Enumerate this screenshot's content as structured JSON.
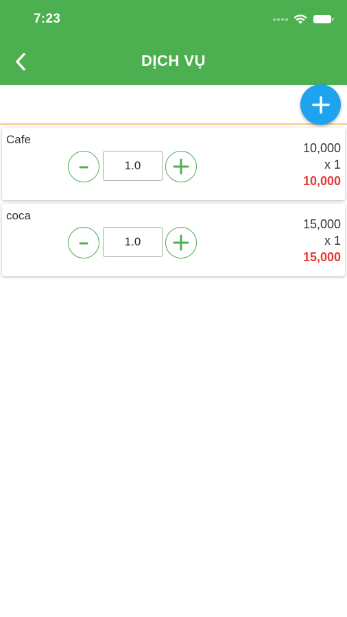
{
  "status_bar": {
    "time": "7:23"
  },
  "header": {
    "title": "DỊCH VỤ",
    "back_icon": "chevron-left-icon"
  },
  "fab": {
    "icon": "plus-icon",
    "color": "#1ea4ee"
  },
  "colors": {
    "primary": "#4caf50",
    "accent_divider": "#f5c88a",
    "total": "#e53935"
  },
  "items": [
    {
      "name": "Cafe",
      "quantity": "1.0",
      "unit_price": "10,000",
      "multiplier": "x 1",
      "total": "10,000"
    },
    {
      "name": "coca",
      "quantity": "1.0",
      "unit_price": "15,000",
      "multiplier": "x 1",
      "total": "15,000"
    }
  ]
}
